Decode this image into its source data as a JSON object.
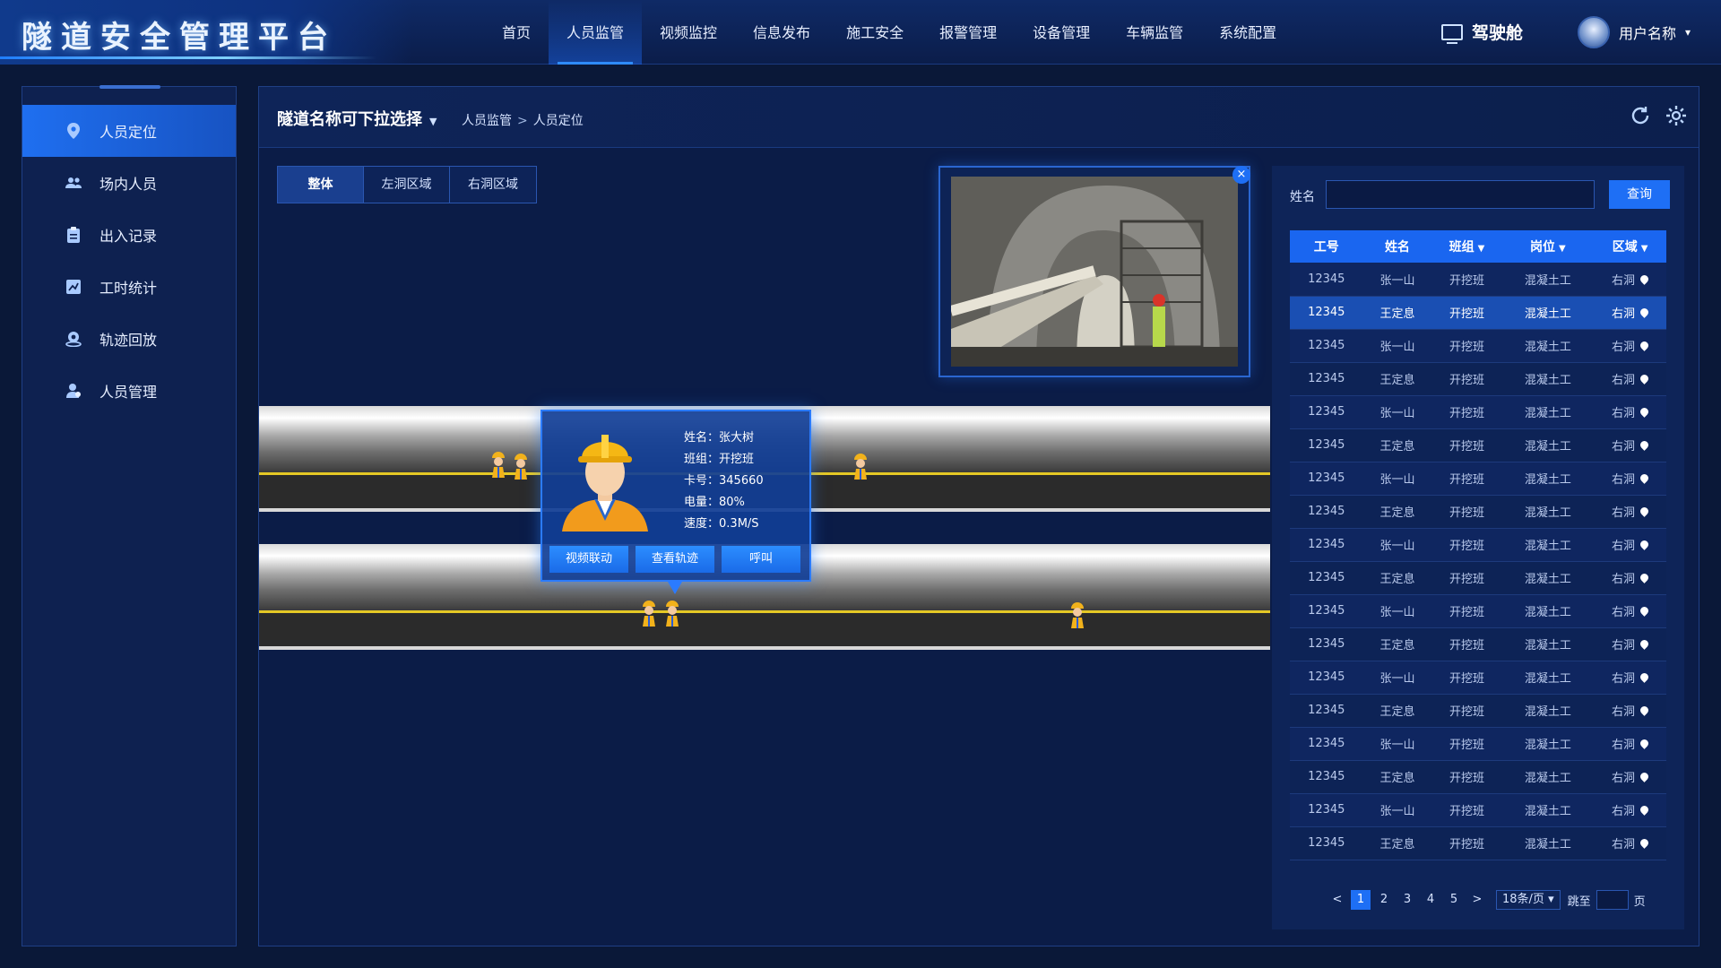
{
  "header": {
    "title": "隧道安全管理平台",
    "nav": [
      "首页",
      "人员监管",
      "视频监控",
      "信息发布",
      "施工安全",
      "报警管理",
      "设备管理",
      "车辆监管",
      "系统配置"
    ],
    "active_nav": "人员监管",
    "cockpit": "驾驶舱",
    "user": "用户名称"
  },
  "sidebar": {
    "items": [
      {
        "label": "人员定位",
        "icon": "location-icon",
        "active": true
      },
      {
        "label": "场内人员",
        "icon": "people-icon"
      },
      {
        "label": "出入记录",
        "icon": "clipboard-icon"
      },
      {
        "label": "工时统计",
        "icon": "chart-icon"
      },
      {
        "label": "轨迹回放",
        "icon": "track-icon"
      },
      {
        "label": "人员管理",
        "icon": "person-icon"
      }
    ]
  },
  "main": {
    "tunnel_select": "隧道名称可下拉选择",
    "breadcrumb": [
      "人员监管",
      "人员定位"
    ],
    "tabs": [
      "整体",
      "左洞区域",
      "右洞区域"
    ],
    "active_tab": "整体"
  },
  "info_popup": {
    "name_label": "姓名：",
    "name": "张大树",
    "team_label": "班组：",
    "team": "开挖班",
    "card_label": "卡号：",
    "card": "345660",
    "battery_label": "电量：",
    "battery": "80%",
    "speed_label": "速度：",
    "speed": "0.3M/S",
    "buttons": [
      "视频联动",
      "查看轨迹",
      "呼叫"
    ]
  },
  "search": {
    "label": "姓名",
    "value": "",
    "button": "查询"
  },
  "table": {
    "headers": [
      "工号",
      "姓名",
      "班组",
      "岗位",
      "区域"
    ],
    "rows": [
      [
        "12345",
        "张一山",
        "开挖班",
        "混凝土工",
        "右洞"
      ],
      [
        "12345",
        "王定息",
        "开挖班",
        "混凝土工",
        "右洞"
      ],
      [
        "12345",
        "张一山",
        "开挖班",
        "混凝土工",
        "右洞"
      ],
      [
        "12345",
        "王定息",
        "开挖班",
        "混凝土工",
        "右洞"
      ],
      [
        "12345",
        "张一山",
        "开挖班",
        "混凝土工",
        "右洞"
      ],
      [
        "12345",
        "王定息",
        "开挖班",
        "混凝土工",
        "右洞"
      ],
      [
        "12345",
        "张一山",
        "开挖班",
        "混凝土工",
        "右洞"
      ],
      [
        "12345",
        "王定息",
        "开挖班",
        "混凝土工",
        "右洞"
      ],
      [
        "12345",
        "张一山",
        "开挖班",
        "混凝土工",
        "右洞"
      ],
      [
        "12345",
        "王定息",
        "开挖班",
        "混凝土工",
        "右洞"
      ],
      [
        "12345",
        "张一山",
        "开挖班",
        "混凝土工",
        "右洞"
      ],
      [
        "12345",
        "王定息",
        "开挖班",
        "混凝土工",
        "右洞"
      ],
      [
        "12345",
        "张一山",
        "开挖班",
        "混凝土工",
        "右洞"
      ],
      [
        "12345",
        "王定息",
        "开挖班",
        "混凝土工",
        "右洞"
      ],
      [
        "12345",
        "张一山",
        "开挖班",
        "混凝土工",
        "右洞"
      ],
      [
        "12345",
        "王定息",
        "开挖班",
        "混凝土工",
        "右洞"
      ],
      [
        "12345",
        "张一山",
        "开挖班",
        "混凝土工",
        "右洞"
      ],
      [
        "12345",
        "王定息",
        "开挖班",
        "混凝土工",
        "右洞"
      ]
    ],
    "selected_row": 1
  },
  "pagination": {
    "prev": "<",
    "next": ">",
    "pages": [
      "1",
      "2",
      "3",
      "4",
      "5"
    ],
    "current": "1",
    "page_size": "18条/页",
    "jump_label": "跳至",
    "page_suffix": "页"
  },
  "colors": {
    "accent": "#1e6ff5",
    "background": "#0a1838",
    "panel": "#0b1c47",
    "highlight_row": "#1a4fb3"
  }
}
